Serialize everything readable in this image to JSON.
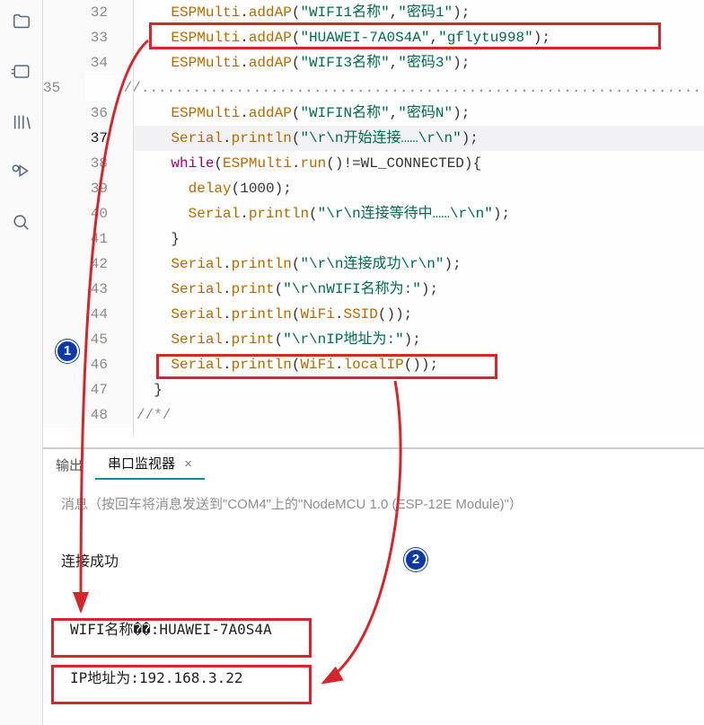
{
  "sidebar": {
    "icons": [
      "folder-icon",
      "board-icon",
      "library-icon",
      "debug-icon",
      "search-icon"
    ]
  },
  "code": {
    "lines": [
      {
        "n": 32,
        "ind": 2,
        "obj": "ESPMulti",
        "call": "addAP",
        "args": [
          "\"WIFI1名称\"",
          "\"密码1\""
        ],
        "tail": ";"
      },
      {
        "n": 33,
        "ind": 2,
        "obj": "ESPMulti",
        "call": "addAP",
        "args": [
          "\"HUAWEI-7A0S4A\"",
          "\"gflytu998\""
        ],
        "tail": ";"
      },
      {
        "n": 34,
        "ind": 2,
        "obj": "ESPMulti",
        "call": "addAP",
        "args": [
          "\"WIFI3名称\"",
          "\"密码3\""
        ],
        "tail": ";"
      },
      {
        "n": 35,
        "ind": 2,
        "comment": "//............................................................................................"
      },
      {
        "n": 36,
        "ind": 2,
        "obj": "ESPMulti",
        "call": "addAP",
        "args": [
          "\"WIFIN名称\"",
          "\"密码N\""
        ],
        "tail": ";"
      },
      {
        "n": 37,
        "ind": 2,
        "obj": "Serial",
        "call": "println",
        "args": [
          "\"\\r\\n开始连接……\\r\\n\""
        ],
        "tail": ";",
        "hl": true,
        "active": true
      },
      {
        "n": 38,
        "ind": 2,
        "ctrl": "while",
        "cond_obj": "ESPMulti",
        "cond_call": "run",
        "cond_rest": "()!=WL_CONNECTED){"
      },
      {
        "n": 39,
        "ind": 3,
        "plain_call": "delay",
        "args_raw": "(1000);"
      },
      {
        "n": 40,
        "ind": 3,
        "obj": "Serial",
        "call": "println",
        "args": [
          "\"\\r\\n连接等待中……\\r\\n\""
        ],
        "tail": ";"
      },
      {
        "n": 41,
        "ind": 2,
        "raw": "}"
      },
      {
        "n": 42,
        "ind": 2,
        "obj": "Serial",
        "call": "println",
        "args": [
          "\"\\r\\n连接成功\\r\\n\""
        ],
        "tail": ";"
      },
      {
        "n": 43,
        "ind": 2,
        "obj": "Serial",
        "call": "print",
        "args": [
          "\"\\r\\nWIFI名称为:\""
        ],
        "tail": ";"
      },
      {
        "n": 44,
        "ind": 2,
        "obj": "Serial",
        "call": "println",
        "inner_obj": "WiFi",
        "inner_call": "SSID",
        "tail": ";"
      },
      {
        "n": 45,
        "ind": 2,
        "obj": "Serial",
        "call": "print",
        "args": [
          "\"\\r\\nIP地址为:\""
        ],
        "tail": ";"
      },
      {
        "n": 46,
        "ind": 2,
        "obj": "Serial",
        "call": "println",
        "inner_obj": "WiFi",
        "inner_call": "localIP",
        "tail": ";"
      },
      {
        "n": 47,
        "ind": 1,
        "raw": "}"
      },
      {
        "n": 48,
        "ind": 0,
        "comment": "//*/"
      }
    ]
  },
  "panel": {
    "tabs": {
      "output": "输出",
      "monitor": "串口监视器"
    },
    "hint": "消息（按回车将消息发送到\"COM4\"上的\"NodeMCU 1.0 (ESP-12E Module)\"）",
    "out1": "连接成功",
    "out2": "WIFI名称��:HUAWEI-7A0S4A",
    "out3": "IP地址为:192.168.3.22"
  },
  "annot": {
    "badge1": "1",
    "badge2": "2"
  }
}
